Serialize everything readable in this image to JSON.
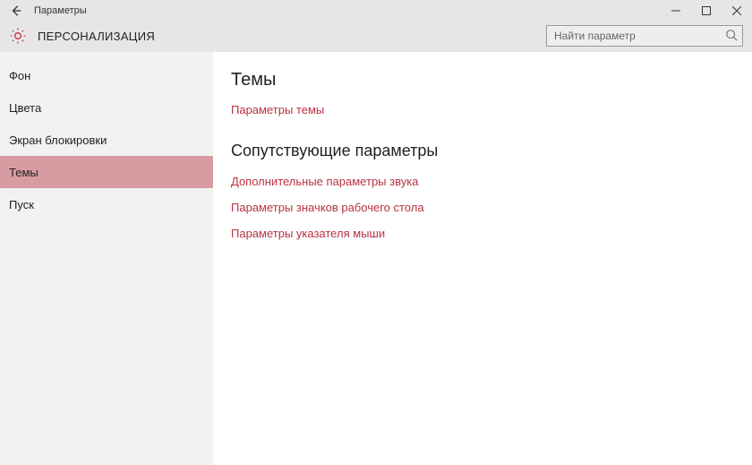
{
  "titlebar": {
    "title": "Параметры"
  },
  "header": {
    "section_title": "ПЕРСОНАЛИЗАЦИЯ",
    "search_placeholder": "Найти параметр"
  },
  "sidebar": {
    "items": [
      {
        "label": "Фон",
        "active": false
      },
      {
        "label": "Цвета",
        "active": false
      },
      {
        "label": "Экран блокировки",
        "active": false
      },
      {
        "label": "Темы",
        "active": true
      },
      {
        "label": "Пуск",
        "active": false
      }
    ]
  },
  "content": {
    "heading1": "Темы",
    "link1": "Параметры темы",
    "heading2": "Сопутствующие параметры",
    "links2": [
      "Дополнительные параметры звука",
      "Параметры значков рабочего стола",
      "Параметры указателя мыши"
    ]
  }
}
